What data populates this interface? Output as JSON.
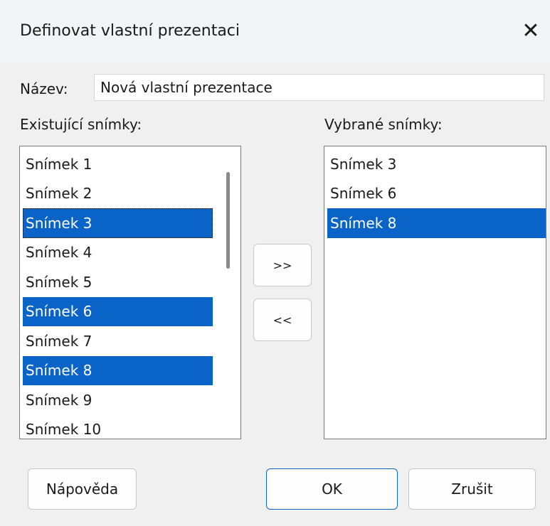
{
  "dialog": {
    "title": "Definovat vlastní prezentaci",
    "close_glyph": "✕"
  },
  "name_field": {
    "label": "Název:",
    "value": "Nová vlastní prezentace"
  },
  "existing": {
    "label": "Existující snímky:",
    "items": [
      {
        "label": "Snímek 1",
        "selected": false
      },
      {
        "label": "Snímek 2",
        "selected": false
      },
      {
        "label": "Snímek 3",
        "selected": true
      },
      {
        "label": "Snímek 4",
        "selected": false
      },
      {
        "label": "Snímek 5",
        "selected": false
      },
      {
        "label": "Snímek 6",
        "selected": true
      },
      {
        "label": "Snímek 7",
        "selected": false
      },
      {
        "label": "Snímek 8",
        "selected": true
      },
      {
        "label": "Snímek 9",
        "selected": false
      },
      {
        "label": "Snímek 10",
        "selected": false
      }
    ]
  },
  "selected_slides": {
    "label": "Vybrané snímky:",
    "items": [
      {
        "label": "Snímek 3",
        "selected": false
      },
      {
        "label": "Snímek 6",
        "selected": false
      },
      {
        "label": "Snímek 8",
        "selected": true
      }
    ]
  },
  "transfer": {
    "add_label": ">>",
    "remove_label": "<<"
  },
  "buttons": {
    "help": "Nápověda",
    "ok": "OK",
    "cancel": "Zrušit"
  },
  "colors": {
    "selection": "#0a64c8",
    "title_bg": "#f2f4f8",
    "dialog_bg": "#f0f0f0",
    "default_button_border": "#0a64c8"
  }
}
